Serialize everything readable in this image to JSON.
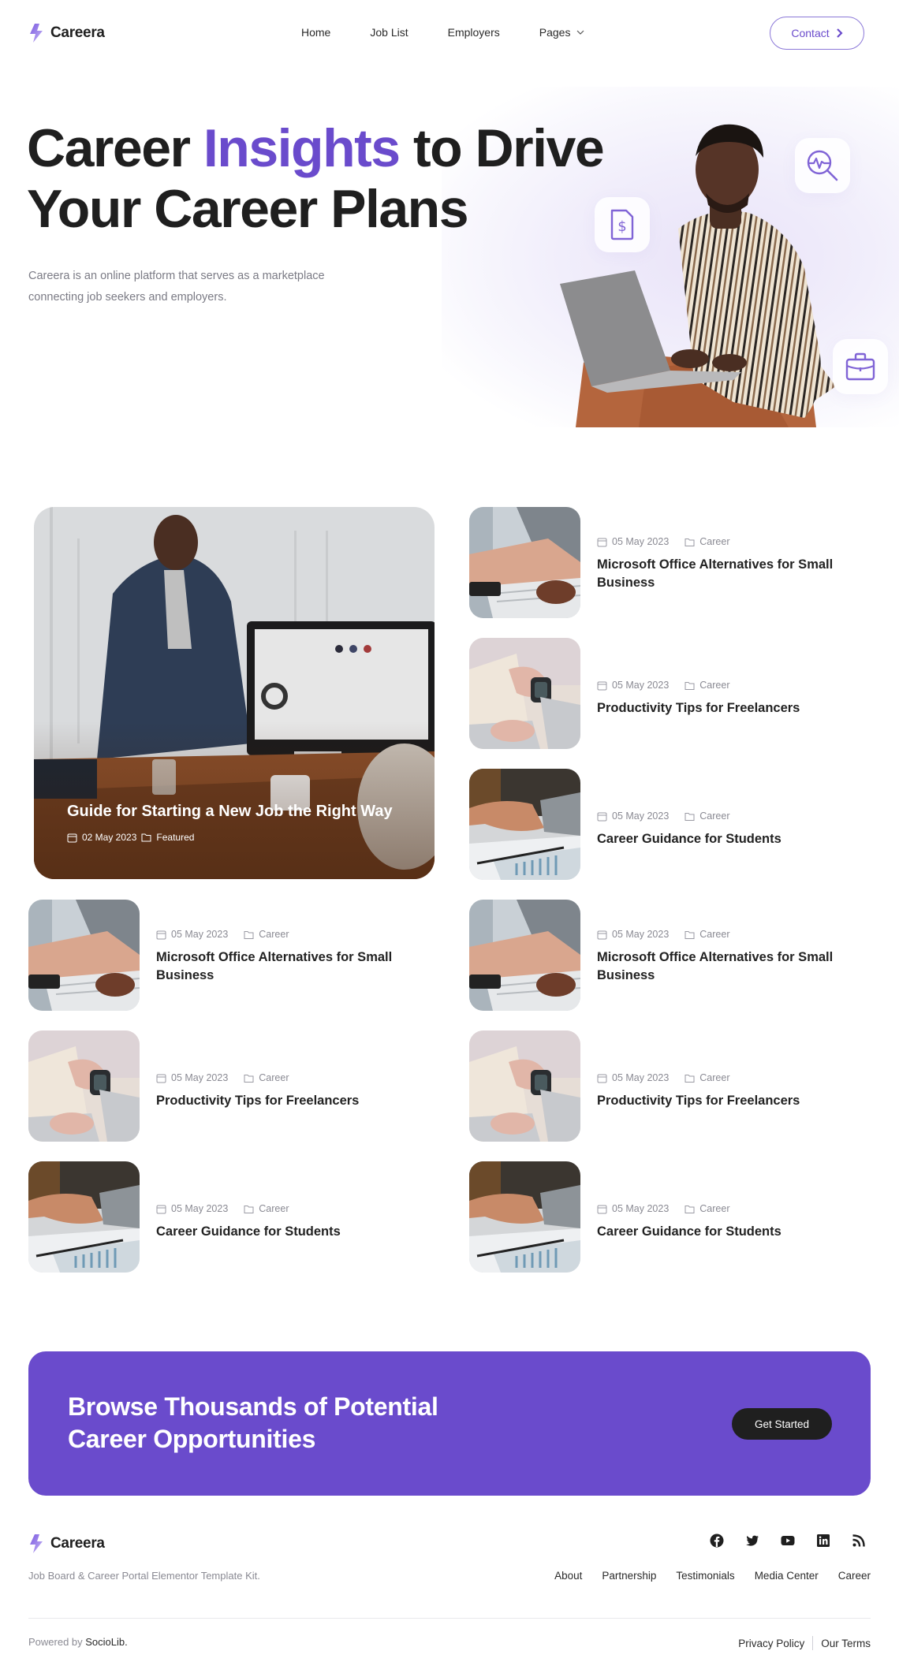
{
  "brand": {
    "name": "Careera",
    "accent_color": "#6a4bcc"
  },
  "nav": {
    "items": [
      {
        "label": "Home"
      },
      {
        "label": "Job List"
      },
      {
        "label": "Employers"
      },
      {
        "label": "Pages",
        "has_dropdown": true
      }
    ],
    "contact_label": "Contact"
  },
  "hero": {
    "title_part1": "Career ",
    "title_accent": "Insights",
    "title_part2": " to Drive",
    "title_line2": "Your Career Plans",
    "description": "Careera is an online platform that serves as a marketplace connecting job seekers and employers.",
    "floating_icons": [
      "invoice-dollar-icon",
      "analytics-search-icon",
      "briefcase-icon"
    ]
  },
  "featured_post": {
    "title": "Guide for Starting a New Job the Right Way",
    "date": "02 May 2023",
    "category": "Featured"
  },
  "posts_right": [
    {
      "date": "05 May 2023",
      "category": "Career",
      "title": "Microsoft Office Alternatives for Small Business",
      "image": "typing-keyboard"
    },
    {
      "date": "05 May 2023",
      "category": "Career",
      "title": "Productivity Tips for Freelancers",
      "image": "smartwatch"
    },
    {
      "date": "05 May 2023",
      "category": "Career",
      "title": "Career Guidance for Students",
      "image": "handshake"
    },
    {
      "date": "05 May 2023",
      "category": "Career",
      "title": "Microsoft Office Alternatives for Small Business",
      "image": "typing-keyboard"
    },
    {
      "date": "05 May 2023",
      "category": "Career",
      "title": "Productivity Tips for Freelancers",
      "image": "smartwatch"
    },
    {
      "date": "05 May 2023",
      "category": "Career",
      "title": "Career Guidance for Students",
      "image": "handshake"
    }
  ],
  "posts_left": [
    {
      "date": "05 May 2023",
      "category": "Career",
      "title": "Microsoft Office Alternatives for Small Business",
      "image": "typing-keyboard"
    },
    {
      "date": "05 May 2023",
      "category": "Career",
      "title": "Productivity Tips for Freelancers",
      "image": "smartwatch"
    },
    {
      "date": "05 May 2023",
      "category": "Career",
      "title": "Career Guidance for Students",
      "image": "handshake"
    }
  ],
  "cta": {
    "title_line1": "Browse Thousands of Potential",
    "title_line2": "Career Opportunities",
    "button_label": "Get Started"
  },
  "footer": {
    "tagline": "Job Board & Career Portal Elementor Template Kit.",
    "socials": [
      "facebook-icon",
      "twitter-icon",
      "youtube-icon",
      "linkedin-icon",
      "rss-icon"
    ],
    "links": [
      "About",
      "Partnership",
      "Testimonials",
      "Media Center",
      "Career"
    ],
    "powered_prefix": "Powered by ",
    "powered_brand": "SocioLib.",
    "legal": [
      "Privacy Policy",
      "Our Terms"
    ]
  }
}
